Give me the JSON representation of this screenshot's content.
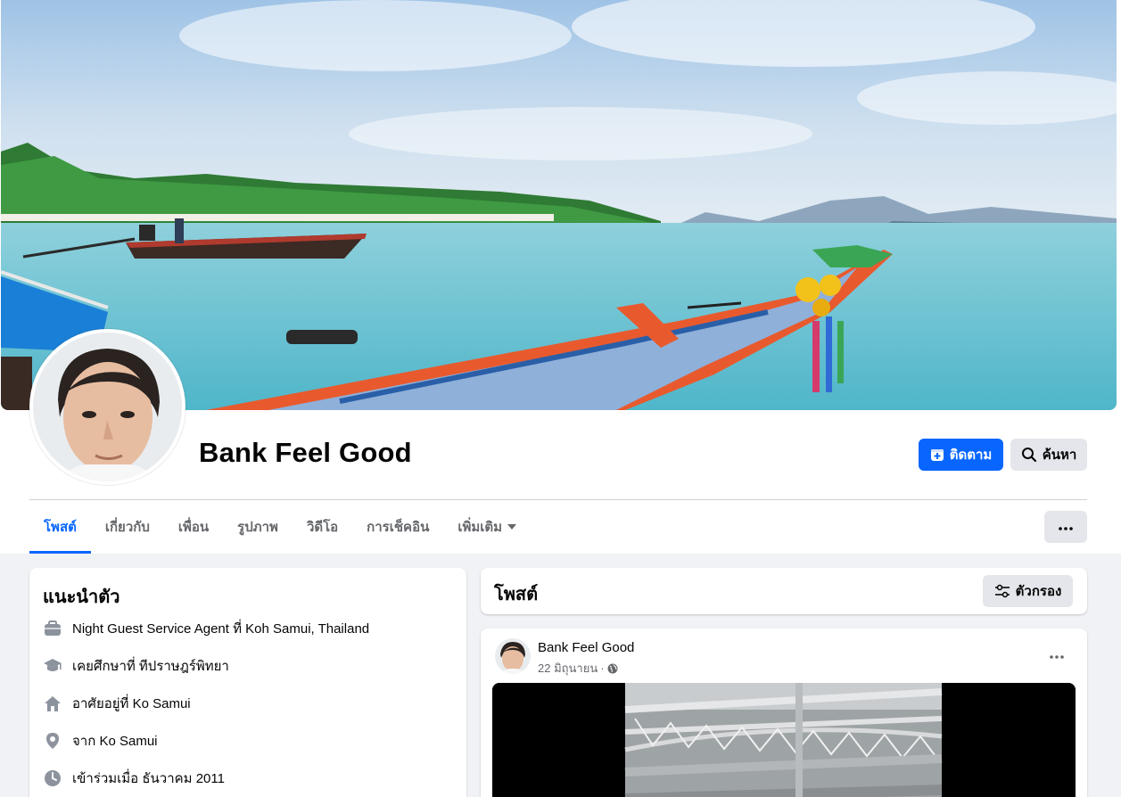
{
  "profile": {
    "name": "Bank Feel Good",
    "follow_label": "ติดตาม",
    "search_label": "ค้นหา"
  },
  "tabs": [
    {
      "label": "โพสต์",
      "active": true
    },
    {
      "label": "เกี่ยวกับ",
      "active": false
    },
    {
      "label": "เพื่อน",
      "active": false
    },
    {
      "label": "รูปภาพ",
      "active": false
    },
    {
      "label": "วิดีโอ",
      "active": false
    },
    {
      "label": "การเช็คอิน",
      "active": false
    },
    {
      "label": "เพิ่มเติม",
      "active": false,
      "has_dropdown": true
    }
  ],
  "intro": {
    "title": "แนะนำตัว",
    "items": [
      {
        "icon": "briefcase-icon",
        "text": "Night Guest Service Agent ที่ Koh Samui, Thailand"
      },
      {
        "icon": "graduation-cap-icon",
        "text": "เคยศึกษาที่ ทีปราษฎร์พิทยา"
      },
      {
        "icon": "home-icon",
        "text": "อาศัยอยู่ที่ Ko Samui"
      },
      {
        "icon": "location-pin-icon",
        "text": "จาก Ko Samui"
      },
      {
        "icon": "clock-icon",
        "text": "เข้าร่วมเมื่อ ธันวาคม 2011"
      }
    ]
  },
  "posts_section": {
    "title": "โพสต์",
    "filter_label": "ตัวกรอง"
  },
  "post": {
    "author": "Bank Feel Good",
    "date": "22 มิถุนายน",
    "separator": "·",
    "privacy_icon": "globe-icon"
  },
  "colors": {
    "accent": "#0866ff",
    "button_gray": "#e4e6eb",
    "page_bg": "#f0f2f5",
    "secondary_text": "#65676b"
  }
}
